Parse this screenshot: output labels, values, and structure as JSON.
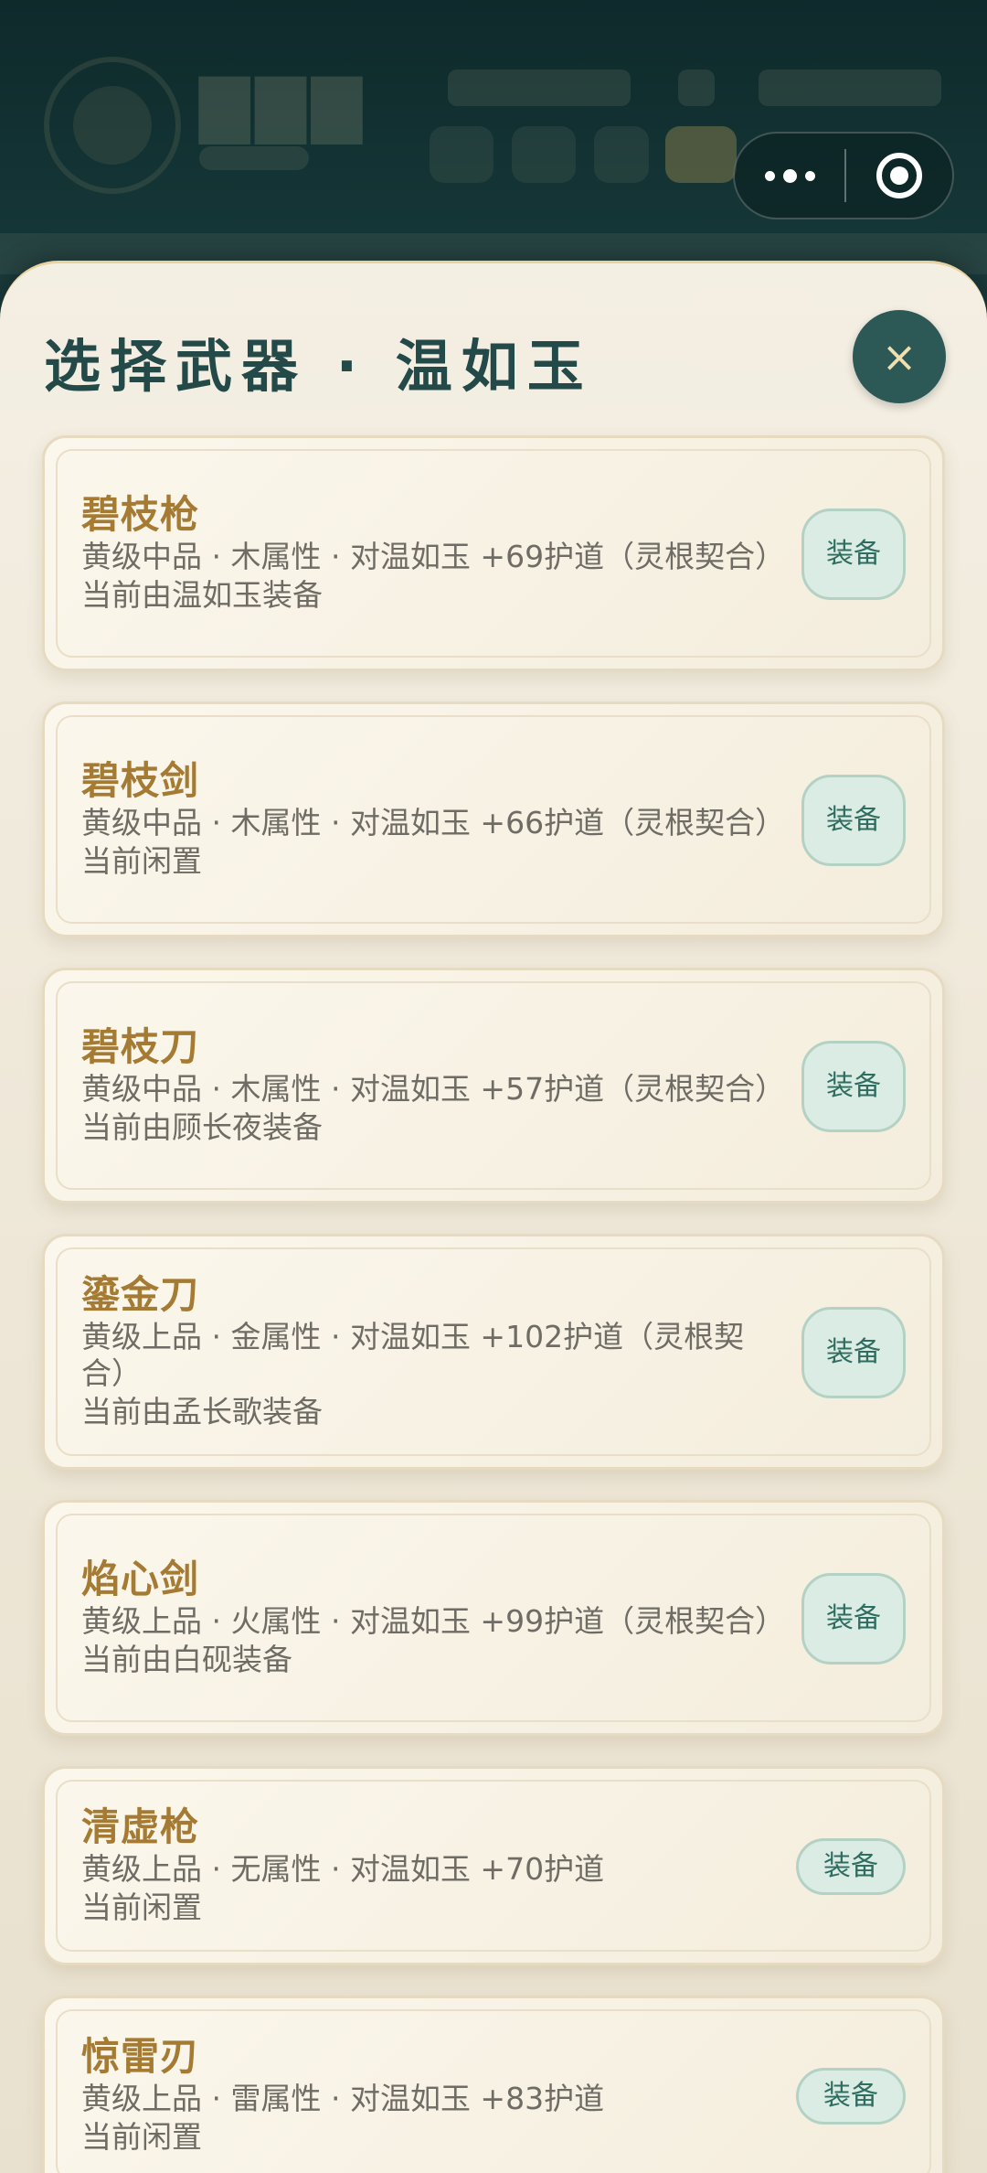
{
  "sheet": {
    "title": "选择武器 · 温如玉",
    "close_label": "×"
  },
  "weapons": [
    {
      "name": "碧枝枪",
      "desc": "黄级中品 · 木属性 · 对温如玉 +69护道（灵根契合）",
      "state": "当前由温如玉装备",
      "action": "装备"
    },
    {
      "name": "碧枝剑",
      "desc": "黄级中品 · 木属性 · 对温如玉 +66护道（灵根契合）",
      "state": "当前闲置",
      "action": "装备"
    },
    {
      "name": "碧枝刀",
      "desc": "黄级中品 · 木属性 · 对温如玉 +57护道（灵根契合）",
      "state": "当前由顾长夜装备",
      "action": "装备"
    },
    {
      "name": "鎏金刀",
      "desc": "黄级上品 · 金属性 · 对温如玉 +102护道（灵根契合）",
      "state": "当前由孟长歌装备",
      "action": "装备"
    },
    {
      "name": "焰心剑",
      "desc": "黄级上品 · 火属性 · 对温如玉 +99护道（灵根契合）",
      "state": "当前由白砚装备",
      "action": "装备"
    },
    {
      "name": "清虚枪",
      "desc": "黄级上品 · 无属性 · 对温如玉 +70护道",
      "state": "当前闲置",
      "action": "装备"
    },
    {
      "name": "惊雷刃",
      "desc": "黄级上品 · 雷属性 · 对温如玉 +83护道",
      "state": "当前闲置",
      "action": "装备"
    }
  ],
  "colors": {
    "accent": "#234a48",
    "weapon_name": "#a57a33",
    "equip_button_bg": "#dbece4",
    "equip_button_text": "#2f6d60",
    "sheet_bg": "#f4efe3"
  },
  "icons": {
    "close": "close-icon",
    "capsule_more": "more-dots-icon",
    "capsule_exit": "target-circle-icon"
  }
}
